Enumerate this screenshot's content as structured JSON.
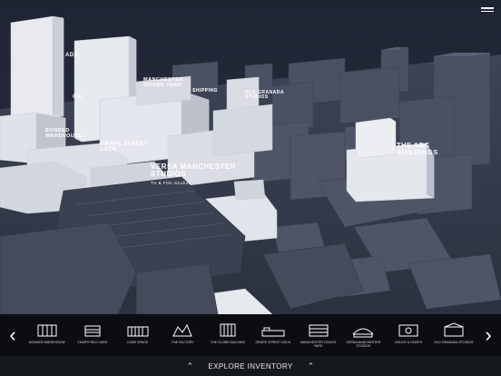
{
  "map": {
    "labels": {
      "manchester_goods_yard_small": "MANCHESTER\nGOODS YARD",
      "granada": "ADA",
      "on": "ON",
      "old_granada": "OLD GRANADA\nSTUDIOS",
      "grape_street_deck": "GRAPE STREET\nDECK",
      "bonded_warehouse": "BONDED\nWAREHOUSE",
      "versa": "VERSA MANCHESTER\nSTUDIOS",
      "versa_sub": "TV & Film Studios",
      "abc": "THE ABC\nBUILDINGS",
      "shipping": "SHIPPING"
    }
  },
  "navigation": {
    "prev_icon": "chevron-left-icon",
    "next_icon": "chevron-right-icon",
    "items": [
      {
        "label": "BONDED WAREHOUSE",
        "icon": "bonded-warehouse-icon"
      },
      {
        "label": "CHARTFIELD YARD",
        "icon": "chartfield-yard-icon"
      },
      {
        "label": "CUBE SPACE",
        "icon": "cube-space-icon"
      },
      {
        "label": "THE FACTORY",
        "icon": "the-factory-icon"
      },
      {
        "label": "THE GLOBE BUILDING",
        "icon": "globe-building-icon"
      },
      {
        "label": "GRAPE STREET DECK",
        "icon": "grape-street-deck-icon"
      },
      {
        "label": "MANCHESTER GOODS YARD",
        "icon": "goods-yard-icon"
      },
      {
        "label": "VERSA MANCHESTER STUDIOS",
        "icon": "versa-studios-icon"
      },
      {
        "label": "DEUCE & HOOPS",
        "icon": "deuce-hoops-icon"
      },
      {
        "label": "OLD GRANADA STUDIOS",
        "icon": "old-granada-icon"
      }
    ]
  },
  "footer": {
    "label": "EXPLORE INVENTORY",
    "left_icon": "chevron-up-icon",
    "right_icon": "chevron-up-icon"
  }
}
